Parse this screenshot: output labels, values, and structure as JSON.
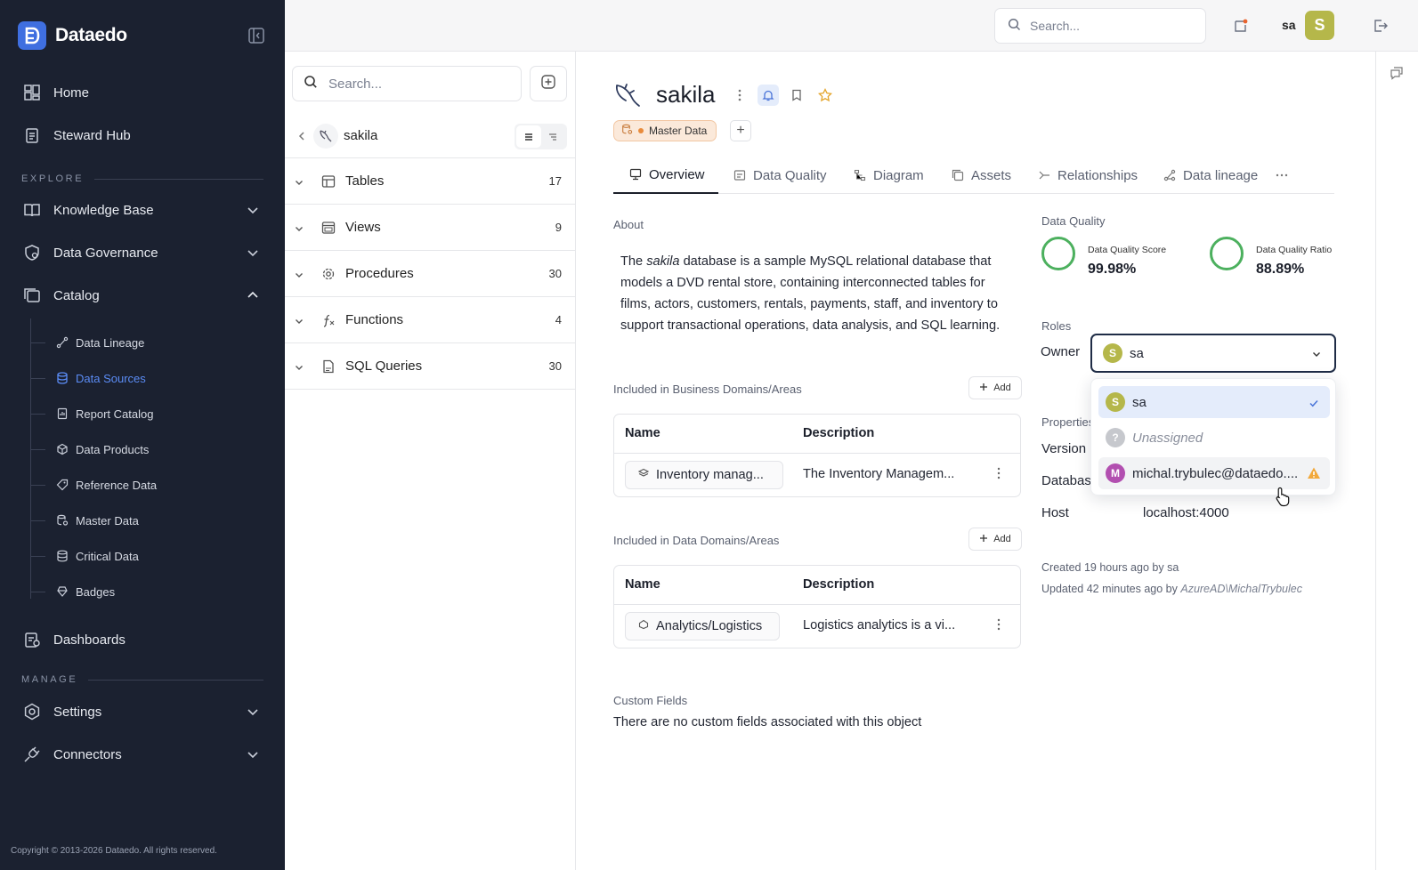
{
  "app": {
    "name": "Dataedo",
    "copyright": "Copyright © 2013-2026 Dataedo. All rights reserved."
  },
  "colors": {
    "sidebar_bg": "#1b2130",
    "accent": "#5b8cf5",
    "avatar": "#b5b74a",
    "quality_ring": "#4cb05e"
  },
  "sidebar": {
    "home": "Home",
    "steward_hub": "Steward Hub",
    "explore_label": "EXPLORE",
    "knowledge_base": "Knowledge Base",
    "data_governance": "Data Governance",
    "catalog": "Catalog",
    "catalog_items": [
      "Data Lineage",
      "Data Sources",
      "Report Catalog",
      "Data Products",
      "Reference Data",
      "Master Data",
      "Critical Data",
      "Badges"
    ],
    "dashboards": "Dashboards",
    "manage_label": "MANAGE",
    "settings": "Settings",
    "connectors": "Connectors"
  },
  "topbar": {
    "search_placeholder": "Search...",
    "user": "sa",
    "avatar_letter": "S"
  },
  "tree": {
    "search_placeholder": "Search...",
    "current": "sakila",
    "rows": [
      {
        "label": "Tables",
        "count": "17"
      },
      {
        "label": "Views",
        "count": "9"
      },
      {
        "label": "Procedures",
        "count": "30"
      },
      {
        "label": "Functions",
        "count": "4"
      },
      {
        "label": "SQL Queries",
        "count": "30"
      }
    ]
  },
  "object": {
    "title": "sakila",
    "tag": "Master Data",
    "tabs": [
      "Overview",
      "Data Quality",
      "Diagram",
      "Assets",
      "Relationships",
      "Data lineage"
    ],
    "about_label": "About",
    "about": {
      "pre": "The ",
      "em": "sakila",
      "post": " database is a sample MySQL relational database that models a DVD rental store, containing interconnected tables for films, actors, customers, rentals, payments, staff, and inventory to support transactional operations, data analysis, and SQL learning."
    },
    "business_domains": {
      "label": "Included in Business Domains/Areas",
      "add": "Add",
      "col_name": "Name",
      "col_desc": "Description",
      "row": {
        "name": "Inventory manag...",
        "desc": "The Inventory Managem..."
      }
    },
    "data_domains": {
      "label": "Included in Data Domains/Areas",
      "add": "Add",
      "col_name": "Name",
      "col_desc": "Description",
      "row": {
        "name": "Analytics/Logistics",
        "desc": "Logistics analytics is a vi..."
      }
    },
    "custom_fields": {
      "label": "Custom Fields",
      "text": "There are no custom fields associated with this object"
    }
  },
  "quality": {
    "label": "Data Quality",
    "score_label": "Data Quality Score",
    "score": "99.98%",
    "ratio_label": "Data Quality Ratio",
    "ratio": "88.89%"
  },
  "roles": {
    "label": "Roles",
    "owner_label": "Owner",
    "owner_value": "sa",
    "owner_letter": "S",
    "options": [
      {
        "letter": "S",
        "label": "sa",
        "color": "#b5b74a"
      },
      {
        "letter": "?",
        "label": "Unassigned",
        "color": "#c6c8cd"
      },
      {
        "letter": "M",
        "label": "michal.trybulec@dataedo....",
        "color": "#b24fb0"
      }
    ]
  },
  "properties": {
    "label": "Properties",
    "version_label": "Version",
    "database_label": "Databas",
    "host_label": "Host",
    "host_value": "localhost:4000"
  },
  "meta": {
    "created": "Created 19 hours ago by sa",
    "updated_pre": "Updated 42 minutes ago by ",
    "updated_by": "AzureAD\\MichalTrybulec"
  }
}
